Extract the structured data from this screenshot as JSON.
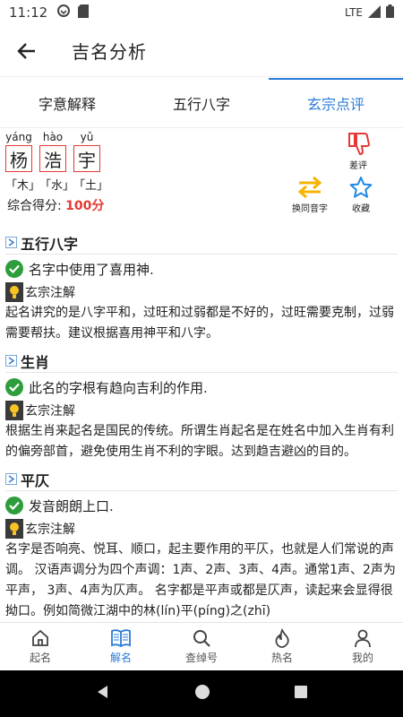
{
  "status": {
    "time": "11:12",
    "network": "LTE"
  },
  "appbar": {
    "title": "吉名分析"
  },
  "tabs": [
    {
      "label": "字意解释"
    },
    {
      "label": "五行八字"
    },
    {
      "label": "玄宗点评"
    }
  ],
  "name": {
    "chars": [
      {
        "pinyin": "yáng",
        "hanzi": "杨",
        "wuxing": "「木」"
      },
      {
        "pinyin": "hào",
        "hanzi": "浩",
        "wuxing": "「水」"
      },
      {
        "pinyin": "yǔ",
        "hanzi": "宇",
        "wuxing": "「土」"
      }
    ],
    "score_label": "综合得分:",
    "score_value": "100分"
  },
  "actions": {
    "dislike": "差评",
    "swap": "换同音字",
    "favorite": "收藏"
  },
  "sections": [
    {
      "title": "五行八字",
      "verdict": "名字中使用了喜用神.",
      "note_title": "玄宗注解",
      "note": "起名讲究的是八字平和，过旺和过弱都是不好的，过旺需要克制，过弱需要帮扶。建议根据喜用神平和八字。"
    },
    {
      "title": "生肖",
      "verdict": "此名的字根有趋向吉利的作用.",
      "note_title": "玄宗注解",
      "note": "根据生肖来起名是国民的传统。所谓生肖起名是在姓名中加入生肖有利的偏旁部首，避免使用生肖不利的字眼。达到趋吉避凶的目的。"
    },
    {
      "title": "平仄",
      "verdict": "发音朗朗上口.",
      "note_title": "玄宗注解",
      "note": "名字是否响亮、悦耳、顺口，起主要作用的平仄，也就是人们常说的声调。 汉语声调分为四个声调：1声、2声、3声、4声。通常1声、2声为平声， 3声、4声为仄声。 名字都是平声或都是仄声，读起来会显得很拗口。例如简微江湖中的林(lín)平(píng)之(zhī)"
    }
  ],
  "bottomnav": [
    {
      "label": "起名",
      "icon": "home-icon"
    },
    {
      "label": "解名",
      "icon": "book-icon"
    },
    {
      "label": "查绰号",
      "icon": "search-icon"
    },
    {
      "label": "热名",
      "icon": "flame-icon"
    },
    {
      "label": "我的",
      "icon": "person-icon"
    }
  ],
  "colors": {
    "accent": "#2a7bd5",
    "red": "#e53935",
    "green": "#2e9e3d",
    "star": "#1e88e5",
    "swap": "#f5b400"
  }
}
